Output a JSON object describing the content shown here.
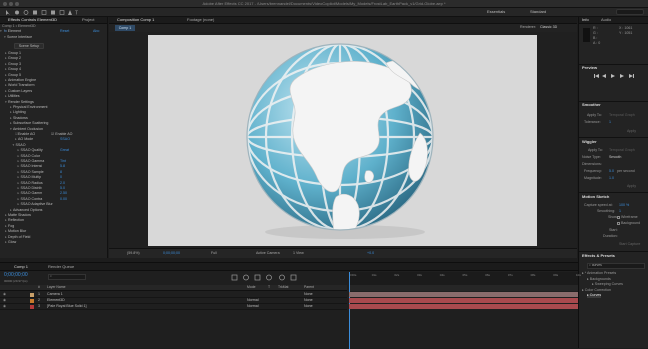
{
  "window": {
    "title": "Adobe After Effects CC 2017 - /Users/brennandel/Documents/VideoCopilot/Models/My_Models/FrostLab_EarthPack_v1/Grid-Globe.aep *"
  },
  "workspaces": {
    "essentials": "Essentials",
    "standard": "Standard"
  },
  "left_panel": {
    "tab_effects": "Effects Controls Element3D",
    "tab_project": "Project",
    "breadcrumb": "Comp 1 • Element3D",
    "effect_name": "Element",
    "reset": "Reset",
    "about": "Abo",
    "scene_interface": "Scene Interface",
    "scene_setup": "Scene Setup",
    "tree": [
      {
        "label": "Group 1",
        "indent": 2
      },
      {
        "label": "Group 2",
        "indent": 2
      },
      {
        "label": "Group 3",
        "indent": 2
      },
      {
        "label": "Group 4",
        "indent": 2
      },
      {
        "label": "Group 5",
        "indent": 2
      },
      {
        "label": "Animation Engine",
        "indent": 2
      },
      {
        "label": "World Transform",
        "indent": 2
      },
      {
        "label": "Custom Layers",
        "indent": 2
      },
      {
        "label": "Utilities",
        "indent": 2
      },
      {
        "label": "Render Settings",
        "indent": 2,
        "open": true
      },
      {
        "label": "Physical Environment",
        "indent": 4
      },
      {
        "label": "Lighting",
        "indent": 4
      },
      {
        "label": "Shadows",
        "indent": 4
      },
      {
        "label": "Subsurface Scattering",
        "indent": 4
      },
      {
        "label": "Ambient Occlusion",
        "indent": 4,
        "open": true
      }
    ],
    "ao": {
      "enable_label": "Enable AO",
      "enable_ao2": "Enable AO",
      "mode_label": "AO Mode",
      "mode_value": "SSAO",
      "ssao_label": "SSAO",
      "rows": [
        {
          "label": "SSAO Quality",
          "value": "Great"
        },
        {
          "label": "SSAO Color",
          "value": ""
        },
        {
          "label": "SSAO Gamma",
          "value": "Tint"
        },
        {
          "label": "SSAO Intensi",
          "value": "5.8"
        },
        {
          "label": "SSAO Sample",
          "value": "8"
        },
        {
          "label": "SSAO Multip",
          "value": "0"
        },
        {
          "label": "SSAO Radius",
          "value": "2.0"
        },
        {
          "label": "SSAO Distrib",
          "value": "5.0"
        },
        {
          "label": "SSAO Gamm",
          "value": "2.50"
        },
        {
          "label": "SSAO Contra",
          "value": "0.00"
        },
        {
          "label": "SSAO Adaptive Blur",
          "value": ""
        }
      ],
      "after": [
        {
          "label": "Advanced Options",
          "indent": 4
        },
        {
          "label": "Matte Shadow",
          "indent": 2
        },
        {
          "label": "Reflection",
          "indent": 2
        },
        {
          "label": "Fog",
          "indent": 2
        },
        {
          "label": "Motion Blur",
          "indent": 2
        },
        {
          "label": "Depth of Field",
          "indent": 2
        },
        {
          "label": "Glow",
          "indent": 2
        }
      ]
    }
  },
  "composition": {
    "tab_comp": "Composition Comp 1",
    "tab_footage": "Footage (none)",
    "subtab": "Comp 1",
    "renderer_label": "Renderer:",
    "renderer_value": "Classic 3D",
    "footer": {
      "zoom": "(59.8%)",
      "timecode": "0;00;00;00",
      "resolution": "Full",
      "camera": "Active Camera",
      "views": "1 View",
      "exposure": "+0.0"
    }
  },
  "right_panel": {
    "info_tab": "Info",
    "audio_tab": "Audio",
    "info": {
      "r": "R :",
      "g": "G :",
      "b": "B :",
      "a": "A : 0",
      "x": "X : 1061",
      "y": "Y : 1051"
    },
    "preview_title": "Preview",
    "smoother": {
      "title": "Smoother",
      "apply_to": "Apply To:",
      "apply_val": "Temporal Graph",
      "tolerance": "Tolerance:",
      "tolerance_val": "1",
      "apply": "Apply"
    },
    "wiggler": {
      "title": "Wiggler",
      "apply_to": "Apply To:",
      "apply_val": "Temporal Graph",
      "noise": "Noise Type:",
      "noise_val": "Smooth",
      "dimensions": "Dimensions:",
      "frequency": "Frequency:",
      "frequency_val": "5.0",
      "per_second": "per second",
      "magnitude": "Magnitude:",
      "magnitude_val": "1.0",
      "apply": "Apply"
    },
    "motion_sketch": {
      "title": "Motion Sketch",
      "capture": "Capture speed at:",
      "capture_val": "100 %",
      "smoothing": "Smoothing:",
      "smoothing_val": "1",
      "show": "Show:",
      "wireframe": "Wireframe",
      "background": "Background",
      "start": "Start:",
      "duration": "Duration:",
      "start_capture": "Start Capture"
    },
    "effects_presets": {
      "title": "Effects & Presets",
      "search": "curves",
      "items": [
        {
          "label": "* Animation Presets",
          "indent": 0
        },
        {
          "label": "Backgrounds",
          "indent": 2
        },
        {
          "label": "Sweeping Curves",
          "indent": 4
        },
        {
          "label": "Color Correction",
          "indent": 0
        },
        {
          "label": "Curves",
          "indent": 2
        }
      ]
    }
  },
  "timeline": {
    "tab_comp": "Comp 1",
    "tab_render": "Render Queue",
    "timecode": "0;00;00;00",
    "frame_info": "00000 (29.97 fps)",
    "search_placeholder": "",
    "headers": {
      "num": "#",
      "source": "Layer Name",
      "mode": "Mode",
      "t": "T",
      "trkmat": "TrkMat",
      "parent": "Parent"
    },
    "layers": [
      {
        "num": "1",
        "name": "Camera 1",
        "color": "#c9a06a",
        "mode": "",
        "parent": "None"
      },
      {
        "num": "2",
        "name": "Element3D",
        "color": "#c97a2b",
        "mode": "Normal",
        "parent": "None"
      },
      {
        "num": "3",
        "name": "[Pale Royal Blue Solid 1]",
        "color": "#b33a3a",
        "mode": "Normal",
        "parent": "None"
      }
    ],
    "ruler_marks": [
      "0:00s",
      "01s",
      "02s",
      "03s",
      "04s",
      "05s",
      "06s",
      "07s",
      "08s",
      "09s",
      "10s"
    ]
  },
  "colors": {
    "accent": "#3b8ddb",
    "layer_bar": "#a84a4e",
    "panel": "#232323",
    "canvas_bg": "#d8d8d8"
  }
}
